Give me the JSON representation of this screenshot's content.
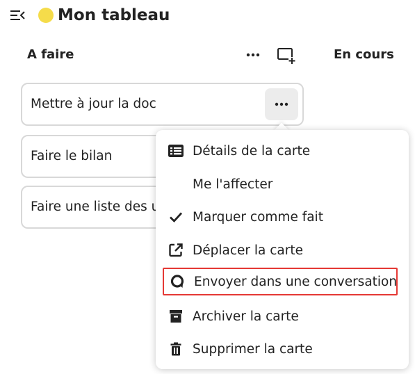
{
  "header": {
    "board_title": "Mon tableau",
    "board_color": "#f5dc4a"
  },
  "columns": [
    {
      "title": "A faire",
      "cards": [
        {
          "title": "Mettre à jour la doc"
        },
        {
          "title": "Faire le bilan"
        },
        {
          "title": "Faire une liste des u"
        }
      ]
    },
    {
      "title": "En cours"
    }
  ],
  "card_menu": {
    "items": [
      {
        "label": "Détails de la carte",
        "icon": "card-details-icon"
      },
      {
        "label": "Me l'affecter",
        "icon": ""
      },
      {
        "label": "Marquer comme fait",
        "icon": "checkmark-icon"
      },
      {
        "label": "Déplacer la carte",
        "icon": "open-in-new-icon"
      },
      {
        "label": "Envoyer dans une conversation",
        "icon": "talk-icon",
        "highlighted": true
      },
      {
        "label": "Archiver la carte",
        "icon": "archive-icon"
      },
      {
        "label": "Supprimer la carte",
        "icon": "delete-icon"
      }
    ]
  },
  "colors": {
    "highlight_border": "#e53935",
    "card_border": "#d8d8d8",
    "text": "#222222"
  }
}
